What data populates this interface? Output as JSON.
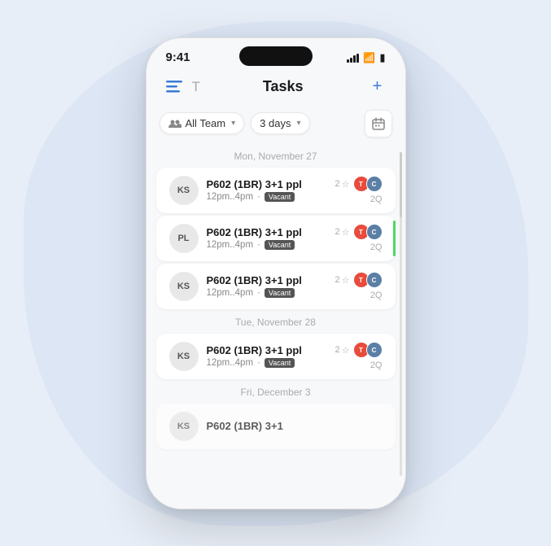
{
  "app": {
    "status_bar": {
      "time": "9:41"
    },
    "header": {
      "title": "Tasks",
      "t_label": "T",
      "plus_label": "+"
    },
    "filters": {
      "team_label": "All Team",
      "days_label": "3 days",
      "team_dropdown_icon": "chevron-down",
      "days_dropdown_icon": "chevron-down"
    },
    "sections": [
      {
        "date": "Mon, November 27",
        "tasks": [
          {
            "avatar": "KS",
            "title": "P602 (1BR) 3+1 ppl",
            "time": "12pm..4pm",
            "badge": "Vacant",
            "star_count": "2",
            "assignees": [
              "T",
              "C"
            ],
            "count": "2Q",
            "green_border": false
          },
          {
            "avatar": "PL",
            "title": "P602 (1BR) 3+1 ppl",
            "time": "12pm..4pm",
            "badge": "Vacant",
            "star_count": "2",
            "assignees": [
              "T",
              "C"
            ],
            "count": "2Q",
            "green_border": true
          },
          {
            "avatar": "KS",
            "title": "P602 (1BR) 3+1 ppl",
            "time": "12pm..4pm",
            "badge": "Vacant",
            "star_count": "2",
            "assignees": [
              "T",
              "C"
            ],
            "count": "2Q",
            "green_border": false
          }
        ]
      },
      {
        "date": "Tue, November 28",
        "tasks": [
          {
            "avatar": "KS",
            "title": "P602 (1BR) 3+1 ppl",
            "time": "12pm..4pm",
            "badge": "Vacant",
            "star_count": "2",
            "assignees": [
              "T",
              "C"
            ],
            "count": "2Q",
            "green_border": false
          }
        ]
      },
      {
        "date": "Fri, December 3",
        "tasks": [
          {
            "avatar": "KS",
            "title": "P602 (1BR) 3+1",
            "time": "",
            "badge": "",
            "star_count": "",
            "assignees": [],
            "count": "",
            "green_border": false,
            "partial": true
          }
        ]
      }
    ],
    "assignee_colors": {
      "T": "#e74c3c",
      "C": "#5b7fa6"
    }
  }
}
